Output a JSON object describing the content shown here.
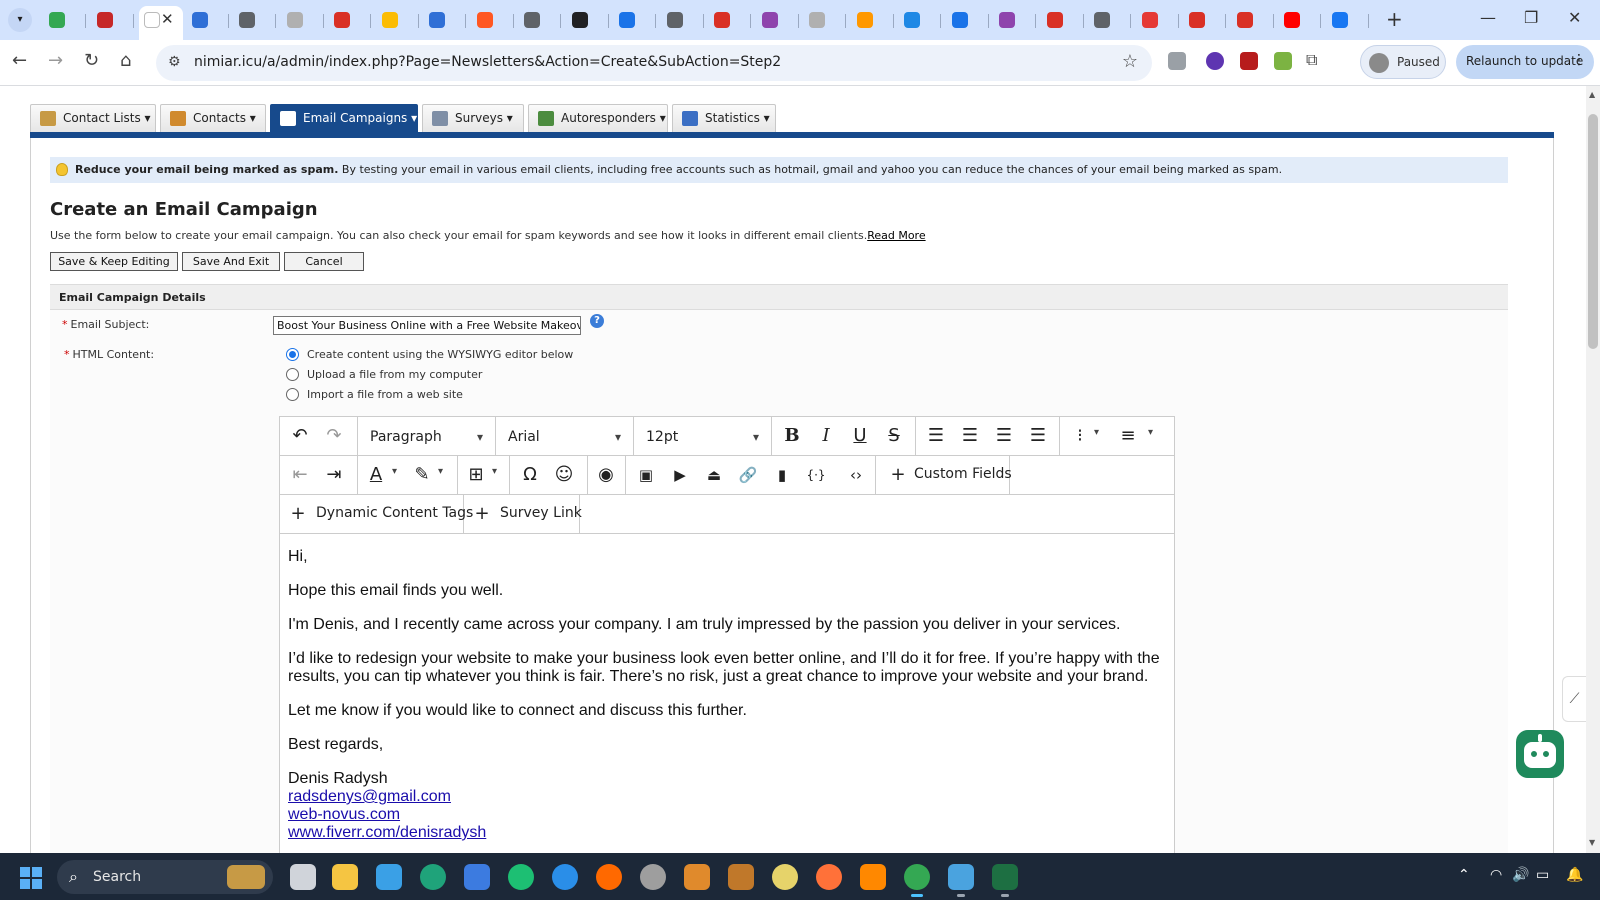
{
  "browser": {
    "url": "nimiar.icu/a/admin/index.php?Page=Newsletters&Action=Create&SubAction=Step2",
    "profile_status": "Paused",
    "relaunch_label": "Relaunch to update",
    "tab_colors": [
      "#34a853",
      "#c62828",
      "#ffffff",
      "#2f6fd6",
      "#5f6368",
      "#b0b0b0",
      "#d93025",
      "#fbbc04",
      "#2f6fd6",
      "#ff5722",
      "#5f6368",
      "#202124",
      "#1a73e8",
      "#5f6368",
      "#d93025",
      "#8e44ad",
      "#b0b0b0",
      "#ff9800",
      "#1e88e5",
      "#1a73e8",
      "#8e44ad",
      "#d93025",
      "#5f6368",
      "#e53935",
      "#d93025",
      "#d93025",
      "#ff0000",
      "#1877f2"
    ]
  },
  "app": {
    "nav_tabs": [
      {
        "label": "Contact Lists",
        "icon": "contact-lists-icon",
        "color": "#c79a45"
      },
      {
        "label": "Contacts",
        "icon": "contacts-icon",
        "color": "#d08a2e"
      },
      {
        "label": "Email Campaigns",
        "icon": "email-icon",
        "color": "#ffffff",
        "active": true
      },
      {
        "label": "Surveys",
        "icon": "survey-icon",
        "color": "#7f8fa6"
      },
      {
        "label": "Autoresponders",
        "icon": "autoresponder-icon",
        "color": "#4c8c3f"
      },
      {
        "label": "Statistics",
        "icon": "statistics-icon",
        "color": "#3b6fc4"
      }
    ],
    "tip": {
      "bold": "Reduce your email being marked as spam.",
      "text": " By testing your email in various email clients, including free accounts such as hotmail, gmail and yahoo you can reduce the chances of your email being marked as spam."
    },
    "title": "Create an Email Campaign",
    "intro": "Use the form below to create your email campaign. You can also check your email for spam keywords and see how it looks in different email clients.",
    "read_more": "Read More",
    "buttons": {
      "save_keep": "Save & Keep Editing",
      "save_exit": "Save And Exit",
      "cancel": "Cancel"
    },
    "section_title": "Email Campaign Details",
    "subject_label": "Email Subject:",
    "subject_value": "Boost Your Business Online with a Free Website Makeover",
    "html_label": "HTML Content:",
    "radio_options": [
      {
        "label": "Create content using the WYSIWYG editor below",
        "checked": true
      },
      {
        "label": "Upload a file from my computer",
        "checked": false
      },
      {
        "label": "Import a file from a web site",
        "checked": false
      }
    ]
  },
  "editor": {
    "block_format": "Paragraph",
    "font_family": "Arial",
    "font_size": "12pt",
    "custom_fields": "Custom Fields",
    "dynamic_tags": "Dynamic Content Tags",
    "survey_link": "Survey Link",
    "body": {
      "greeting": "Hi,",
      "p1": "Hope this email finds you well.",
      "p2": "I'm Denis, and I recently came across your company. I am truly impressed by the passion you deliver in your services.",
      "p3": "I’d like to redesign your website to make your business look even better online, and I’ll do it for free. If you’re happy with the results, you can tip whatever you think is fair. There’s no risk, just a great chance to improve your website and your brand.",
      "p4": "Let me know if you would like to connect and discuss this further.",
      "closing": "Best regards,",
      "name": "Denis Radysh",
      "email": "radsdenys@gmail.com",
      "site": "web-novus.com",
      "fiverr": "www.fiverr.com/denisradysh"
    }
  },
  "taskbar": {
    "search_label": "Search",
    "apps": [
      {
        "name": "task-view-icon",
        "color": "#d0d4da"
      },
      {
        "name": "file-explorer-icon",
        "color": "#f5c542"
      },
      {
        "name": "weather-app-icon",
        "color": "#3aa0e6"
      },
      {
        "name": "edge-icon",
        "color": "#1fa37a"
      },
      {
        "name": "store-icon",
        "color": "#3c7be0"
      },
      {
        "name": "fiverr-app-icon",
        "color": "#1dbf73"
      },
      {
        "name": "telegram-like-icon",
        "color": "#2a8ee8"
      },
      {
        "name": "mi-app-icon",
        "color": "#ff6900"
      },
      {
        "name": "media-icon",
        "color": "#9e9e9e"
      },
      {
        "name": "app-icon-orange",
        "color": "#e08a2c"
      },
      {
        "name": "photo-app-icon",
        "color": "#c0782a"
      },
      {
        "name": "disc-icon",
        "color": "#e6d36a"
      },
      {
        "name": "firefox-icon",
        "color": "#ff7139"
      },
      {
        "name": "vlc-icon",
        "color": "#ff8800"
      },
      {
        "name": "chrome-icon",
        "color": "#34a853"
      },
      {
        "name": "notepad-icon",
        "color": "#4aa3df"
      },
      {
        "name": "excel-icon",
        "color": "#1d6f42"
      }
    ]
  }
}
